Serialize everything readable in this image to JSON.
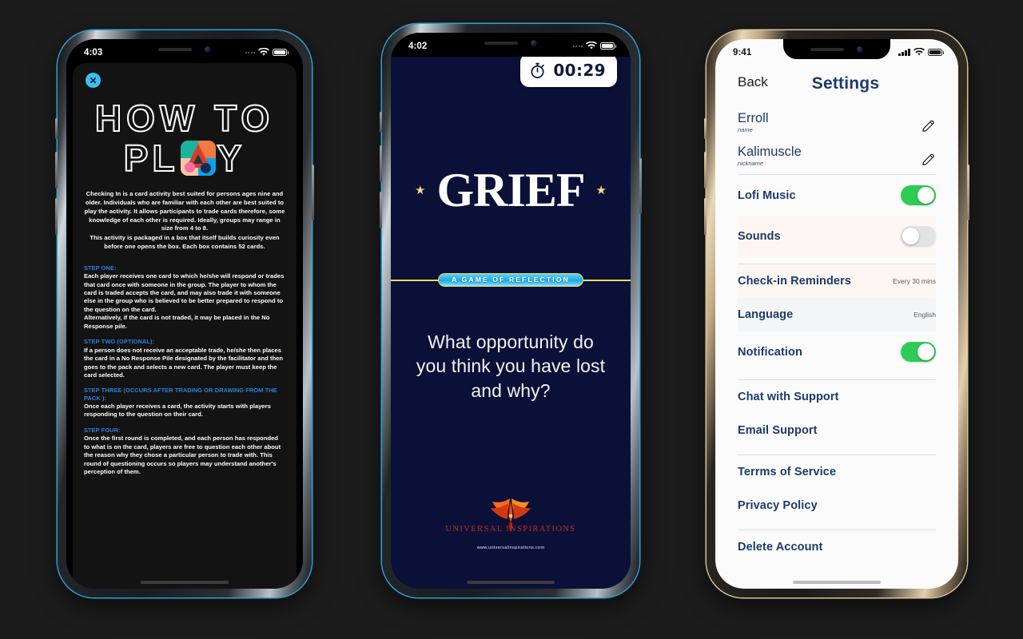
{
  "background_color": "#1c1c1c",
  "phones": {
    "how_to_play": {
      "frame_color": "#2aa3d8",
      "status_bar": {
        "time": "4:03"
      },
      "close_icon": "✕",
      "title_line1": "HOW TO",
      "title_line2_before": "PL",
      "title_line2_after": "Y",
      "intro": [
        "Checking In is a card activity best suited for persons ages nine and older. Individuals who are familiar with each other are best suited to play the activity. It allows participants to trade cards therefore, some knowledge of each other is required. Ideally, groups may range in size from 4 to 8.",
        "This activity is packaged in a box that itself builds curiosity even before one opens the box. Each box contains 52 cards."
      ],
      "steps": [
        {
          "heading": "STEP ONE:",
          "body": [
            "Each player receives one card to which he/she will respond or trades that card once with someone in the group. The player to whom the card is traded accepts the card, and may also trade it with someone else in the group who is believed to be better prepared to respond to the question on the card.",
            "Alternatively, if the card is not traded, it may be placed in the No Response pile."
          ]
        },
        {
          "heading": "STEP TWO (OPTIONAL):",
          "body": [
            "If a person does not receive an acceptable trade, he/she then places the card in a No Response Pile designated by the facilitator and then goes to the pack and selects a new card. The player must keep the card selected."
          ]
        },
        {
          "heading": "STEP THREE (OCCURS AFTER TRADING OR DRAWING FROM THE PACK ):",
          "body": [
            "Once each player receives a card, the activity starts with players responding to the question on their card."
          ]
        },
        {
          "heading": "STEP FOUR:",
          "body": [
            "Once the first round is completed, and each person has responded to what is on the card, players are free to question each other about the reason why they chose a particular person to trade with. This round of questioning occurs so players may understand another's perception of them."
          ]
        }
      ]
    },
    "grief": {
      "frame_color": "#2aa3d8",
      "screen_color": "#0b1038",
      "status_bar": {
        "time": "4:02"
      },
      "timer": {
        "value": "00:29",
        "icon": "stopwatch-icon"
      },
      "logo_text": "GRIEF",
      "star_left": "★",
      "star_right": "★",
      "ribbon_text": "A GAME OF REFLECTION",
      "ribbon_accent": "#e8e05a",
      "question": "What opportunity do you think you have lost and why?",
      "brand": {
        "name": "UNIVERSAL INSPIRATIONS",
        "url": "www.universalinspirations.com"
      }
    },
    "settings": {
      "frame_color": "#d9c49b",
      "status_bar": {
        "time": "9:41"
      },
      "back_label": "Back",
      "title": "Settings",
      "profile": [
        {
          "value": "Erroll",
          "label": "name",
          "icon": "pencil-icon"
        },
        {
          "value": "Kalimuscle",
          "label": "nickname",
          "icon": "pencil-icon"
        }
      ],
      "toggles_group_1": [
        {
          "label": "Lofi Music",
          "state": "on"
        },
        {
          "label": "Sounds",
          "state": "off"
        }
      ],
      "preferences": [
        {
          "label": "Check-in Reminders",
          "value": "Every 30 mins",
          "type": "value"
        },
        {
          "label": "Language",
          "value": "English",
          "type": "value"
        },
        {
          "label": "Notification",
          "state": "on",
          "type": "toggle"
        }
      ],
      "support": [
        {
          "label": "Chat with Support"
        },
        {
          "label": "Email Support"
        }
      ],
      "legal": [
        {
          "label": "Terrms of Service"
        },
        {
          "label": "Privacy Policy"
        }
      ],
      "danger": [
        {
          "label": "Delete Account"
        }
      ],
      "toggle_on_color": "#2ecc55",
      "toggle_off_color": "#e2e3e5"
    }
  }
}
